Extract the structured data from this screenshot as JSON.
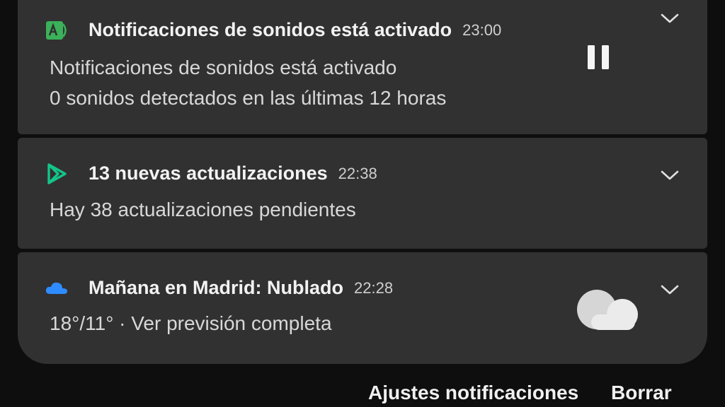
{
  "notifications": [
    {
      "app_icon": "sound-notification-icon",
      "icon_color": "#3bb15a",
      "title": "Notificaciones de sonidos está activado",
      "time": "23:00",
      "line1": "Notificaciones de sonidos está activado",
      "line2": "0 sonidos detectados en las últimas 12 horas",
      "action_icon": "pause-icon"
    },
    {
      "app_icon": "play-store-icon",
      "icon_color": "#14c58a",
      "title": "13 nuevas actualizaciones",
      "time": "22:38",
      "line1": "Hay 38 actualizaciones pendientes"
    },
    {
      "app_icon": "weather-cloud-icon",
      "icon_color": "#2f8cff",
      "title": "Mañana en Madrid: Nublado",
      "time": "22:28",
      "line1": "18°/11° · Ver previsión completa",
      "action_icon": "cloudy-weather-icon"
    }
  ],
  "footer": {
    "settings_label": "Ajustes notificaciones",
    "clear_label": "Borrar"
  }
}
